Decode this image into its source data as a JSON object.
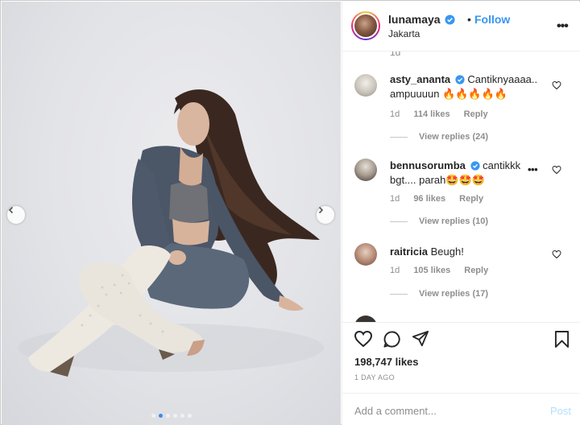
{
  "post": {
    "username": "lunamaya",
    "follow_label": "Follow",
    "separator": "•",
    "location": "Jakarta",
    "more_label": "•••"
  },
  "carousel": {
    "slide_count": 6,
    "active_index": 1
  },
  "comments": [
    {
      "username": "asty_ananta",
      "verified": true,
      "text": "Cantiknyaaaa.. ampuuuun 🔥🔥🔥🔥🔥",
      "age": "1d",
      "likes": "114 likes",
      "reply_label": "Reply",
      "view_replies": "View replies (24)"
    },
    {
      "username": "bennusorumba",
      "verified": true,
      "text": "cantikkk bgt.... parah🤩🤩🤩",
      "age": "1d",
      "likes": "96 likes",
      "reply_label": "Reply",
      "view_replies": "View replies (10)",
      "more_label": "•••"
    },
    {
      "username": "raitricia",
      "verified": false,
      "text": "Beugh!",
      "age": "1d",
      "likes": "105 likes",
      "reply_label": "Reply",
      "view_replies": "View replies (17)"
    }
  ],
  "ghost_text": "1d",
  "stats": {
    "likes": "198,747 likes",
    "time_ago": "1 DAY AGO"
  },
  "composer": {
    "placeholder": "Add a comment...",
    "post_label": "Post"
  },
  "colors": {
    "accent": "#3897f0",
    "post_disabled": "#b2dffc",
    "muted": "#8e8e8e",
    "text": "#262626"
  },
  "icons": [
    "verified-badge-icon",
    "more-options-icon",
    "heart-icon",
    "comment-icon",
    "share-icon",
    "bookmark-icon",
    "chevron-left-icon",
    "chevron-right-icon"
  ]
}
